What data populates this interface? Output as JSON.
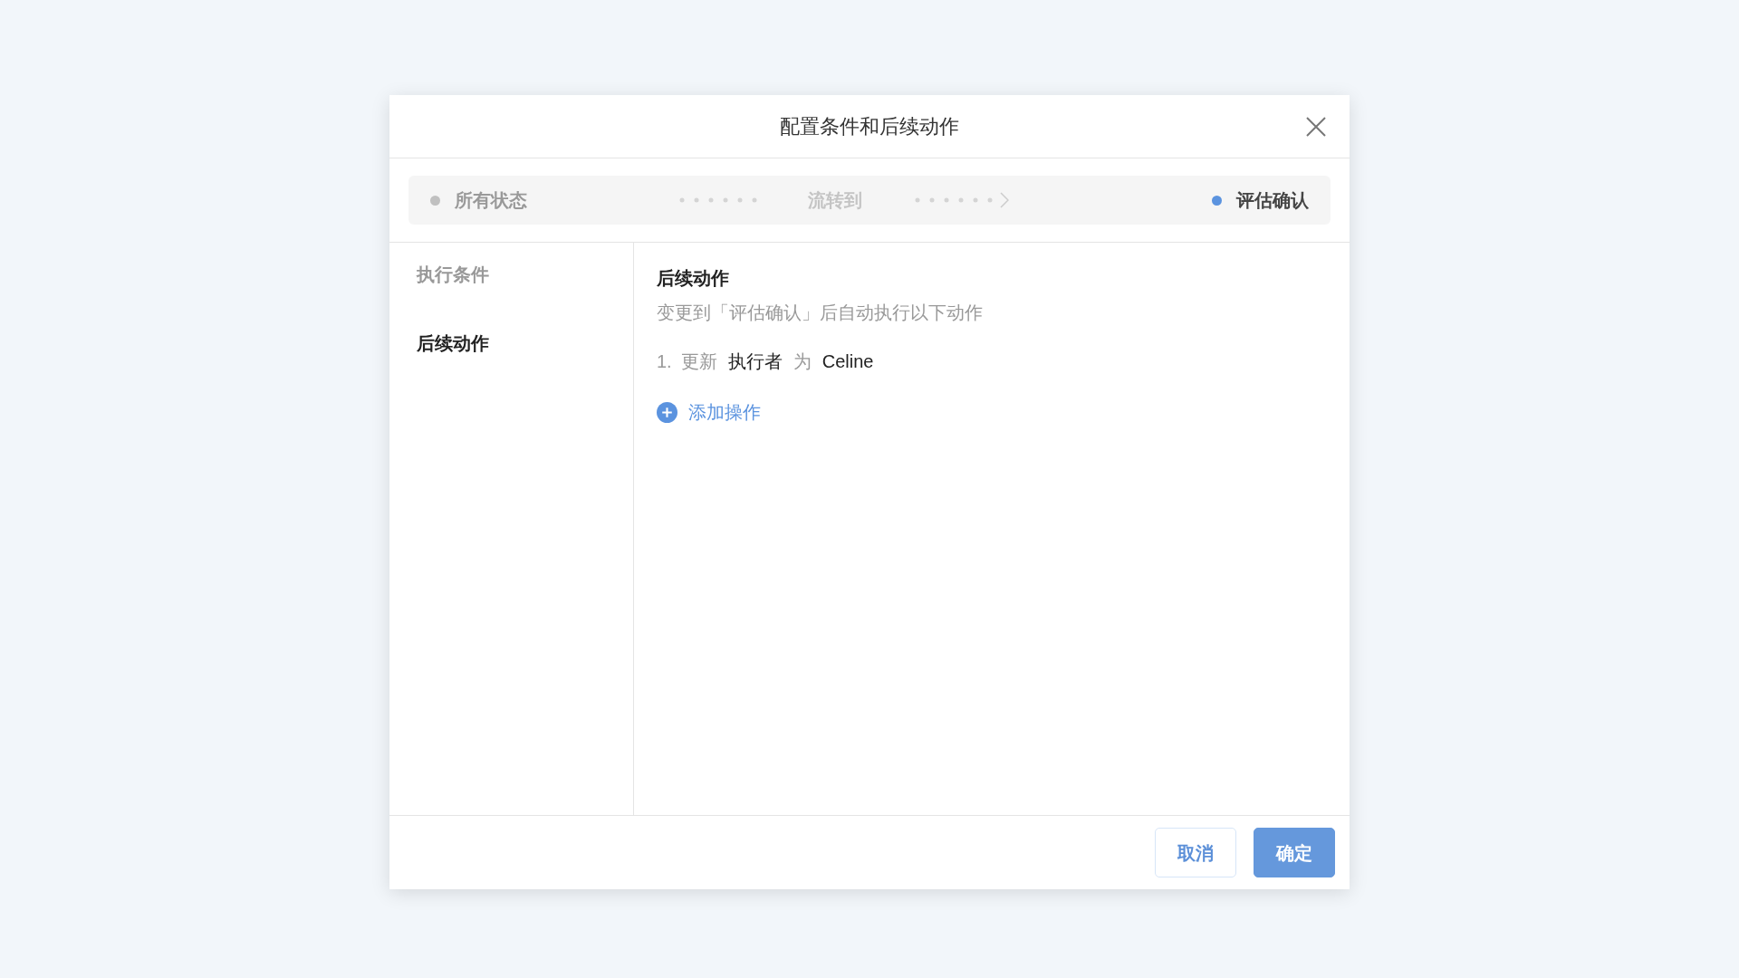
{
  "dialog": {
    "title": "配置条件和后续动作"
  },
  "flow": {
    "from": {
      "label": "所有状态",
      "color": "#c0c0c0"
    },
    "via": "流转到",
    "to": {
      "label": "评估确认",
      "color": "#5b93df"
    }
  },
  "sidebar": {
    "items": [
      {
        "label": "执行条件",
        "selected": false
      },
      {
        "label": "后续动作",
        "selected": true
      }
    ]
  },
  "section": {
    "title": "后续动作",
    "description": "变更到「评估确认」后自动执行以下动作",
    "actions": [
      {
        "index": "1.",
        "verb": "更新",
        "field": "执行者",
        "prep": "为",
        "value": "Celine"
      }
    ],
    "add_label": "添加操作"
  },
  "buttons": [
    {
      "label": "取消",
      "kind": "secondary"
    },
    {
      "label": "确定",
      "kind": "primary"
    }
  ]
}
